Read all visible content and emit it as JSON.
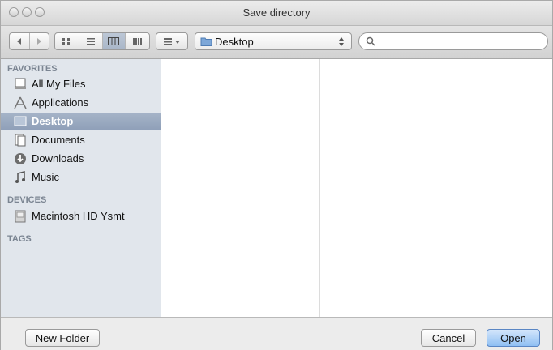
{
  "window": {
    "title": "Save directory"
  },
  "toolbar": {
    "back_icon": "back-arrow",
    "forward_icon": "forward-arrow",
    "view_modes": [
      "icon-view",
      "list-view",
      "column-view",
      "coverflow-view"
    ],
    "active_view": "column-view",
    "arrange_icon": "arrange-grid",
    "path": {
      "label": "Desktop",
      "icon": "folder"
    },
    "search": {
      "placeholder": "",
      "value": ""
    }
  },
  "sidebar": {
    "groups": [
      {
        "label": "FAVORITES",
        "items": [
          {
            "label": "All My Files",
            "icon": "all-files"
          },
          {
            "label": "Applications",
            "icon": "applications"
          },
          {
            "label": "Desktop",
            "icon": "desktop",
            "selected": true
          },
          {
            "label": "Documents",
            "icon": "documents"
          },
          {
            "label": "Downloads",
            "icon": "downloads"
          },
          {
            "label": "Music",
            "icon": "music"
          }
        ]
      },
      {
        "label": "DEVICES",
        "items": [
          {
            "label": "Macintosh HD Ysmt",
            "icon": "hard-drive"
          }
        ]
      },
      {
        "label": "TAGS",
        "items": []
      }
    ]
  },
  "buttons": {
    "new_folder": "New Folder",
    "cancel": "Cancel",
    "open": "Open"
  },
  "colors": {
    "selection": "#8e9fb8",
    "sidebar_bg": "#e1e6ec",
    "primary_button": "#8fbff3",
    "group_header": "#7b8592"
  }
}
